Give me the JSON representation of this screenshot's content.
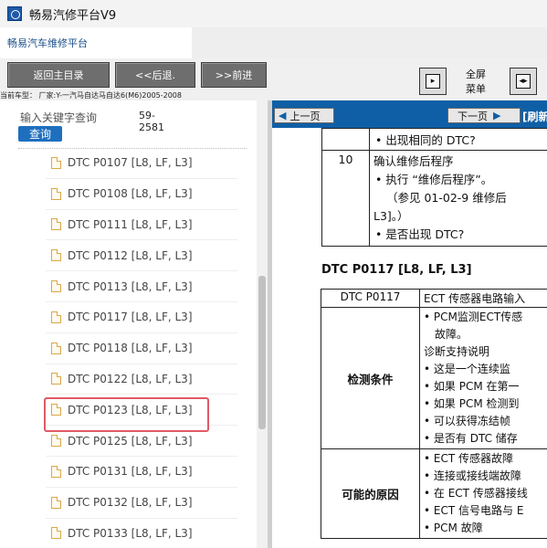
{
  "window": {
    "title": "畅易汽修平台V9"
  },
  "tab": {
    "label": "畅易汽车维修平台"
  },
  "toolbar": {
    "home_label": "返回主目录",
    "back_label": "<<后退.",
    "forward_label": ">>前进",
    "fullscreen_line1": "全屏",
    "fullscreen_line2": "菜单",
    "car_label": "当前车型： 厂家:Y-一汽马自达马自达6(M6)2005-2008"
  },
  "search": {
    "placeholder": "输入关键字查询",
    "button_label": "查询",
    "range_line1": "59-",
    "range_line2": "2581"
  },
  "tree": {
    "items": [
      {
        "label": "DTC P0107 [L8, LF, L3]"
      },
      {
        "label": "DTC P0108 [L8, LF, L3]"
      },
      {
        "label": "DTC P0111 [L8, LF, L3]"
      },
      {
        "label": "DTC P0112 [L8, LF, L3]"
      },
      {
        "label": "DTC P0113 [L8, LF, L3]"
      },
      {
        "label": "DTC P0117 [L8, LF, L3]",
        "selected": true
      },
      {
        "label": "DTC P0118 [L8, LF, L3]"
      },
      {
        "label": "DTC P0122 [L8, LF, L3]"
      },
      {
        "label": "DTC P0123 [L8, LF, L3]"
      },
      {
        "label": "DTC P0125 [L8, LF, L3]"
      },
      {
        "label": "DTC P0131 [L8, LF, L3]"
      },
      {
        "label": "DTC P0132 [L8, LF, L3]"
      },
      {
        "label": "DTC P0133 [L8, LF, L3]"
      }
    ]
  },
  "doc_nav": {
    "prev_label": "上一页",
    "next_label": "下一页",
    "refresh_label": "[刷新"
  },
  "document": {
    "top_row_text": "出现相同的 DTC?",
    "step_number": "10",
    "step_title": "确认维修后程序",
    "step_bullet1": "执行 “维修后程序”。",
    "step_ref": "（参见 01-02-9 维修后",
    "step_ref2": "L3]。）",
    "step_bullet2": "是否出现 DTC?",
    "section_title": "DTC P0117 [L8, LF, L3]",
    "dtc_code": "DTC P0117",
    "dtc_desc": "ECT 传感器电路输入",
    "detect_label": "检测条件",
    "detect_lines": [
      "PCM监测ECT传感",
      "故障。",
      "诊断支持说明",
      "这是一个连续监",
      "如果 PCM 在第一",
      "如果 PCM 检测到",
      "可以获得冻结帧",
      "是否有 DTC 储存"
    ],
    "cause_label": "可能的原因",
    "cause_lines": [
      "ECT 传感器故障",
      "连接或接线端故障",
      "在 ECT 传感器接线",
      "ECT 信号电路与 E",
      "PCM 故障"
    ]
  },
  "colors": {
    "nav_blue": "#0f5fa6",
    "query_button": "#1f6fbf",
    "selection_outline": "#e05a66",
    "toolbar_button": "#6e6e6e"
  }
}
